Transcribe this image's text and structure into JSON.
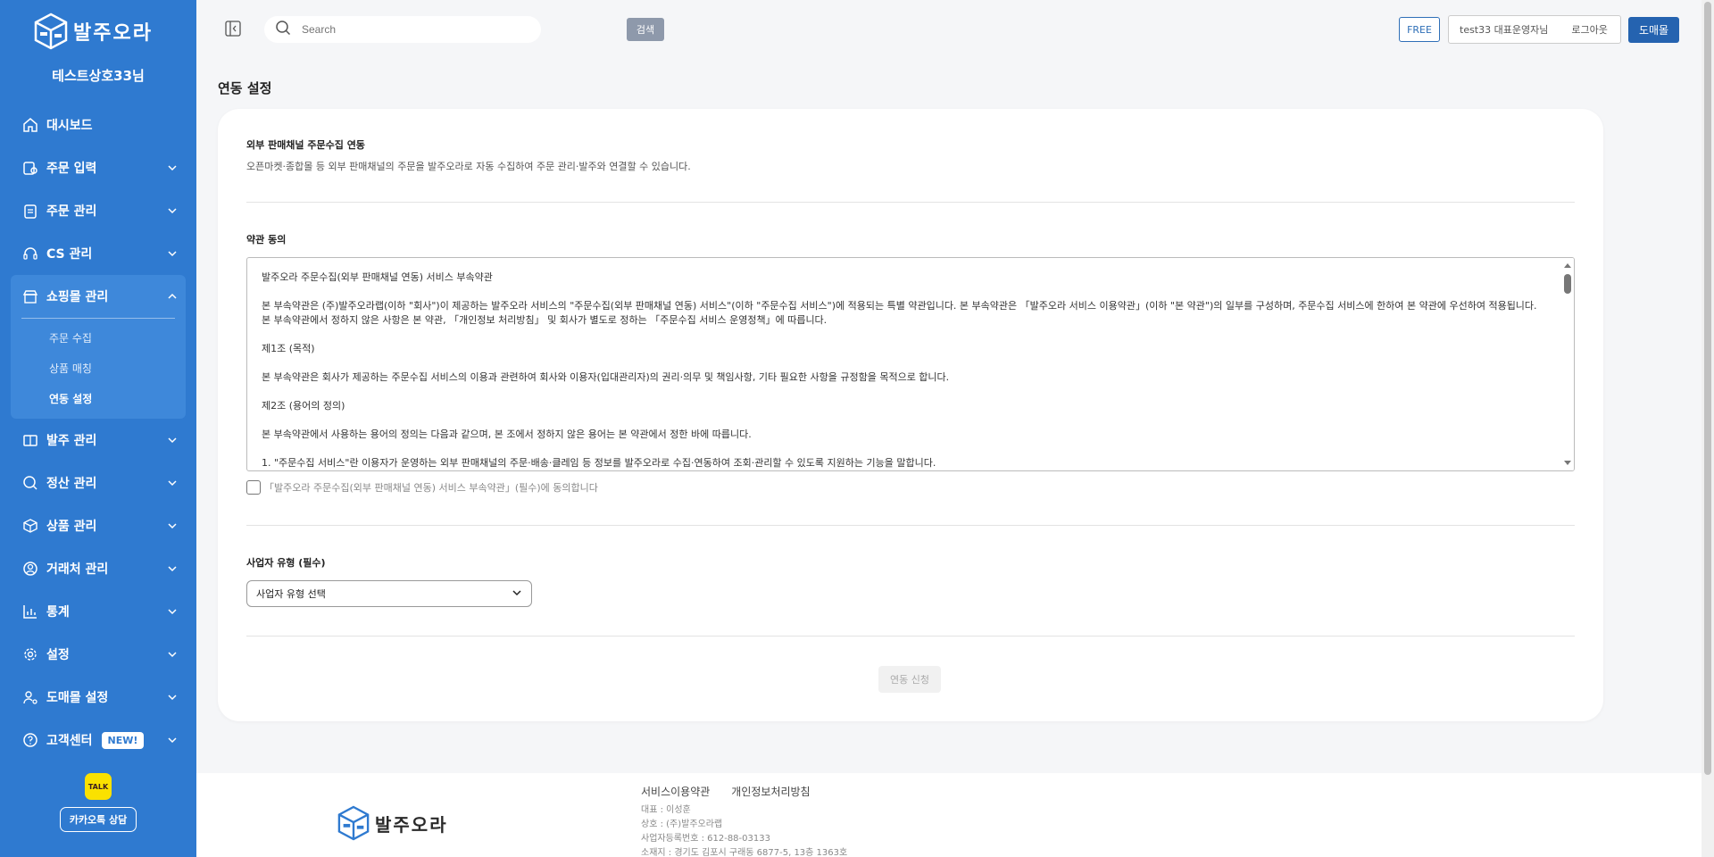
{
  "brand": {
    "name": "발주오라",
    "accent": "#2f7ad0"
  },
  "sidebar": {
    "company": "테스트상호33님",
    "items": [
      {
        "label": "대시보드",
        "icon": "home-icon"
      },
      {
        "label": "주문 입력",
        "icon": "order-input-icon"
      },
      {
        "label": "주문 관리",
        "icon": "clipboard-icon"
      },
      {
        "label": "CS 관리",
        "icon": "headset-icon"
      },
      {
        "label": "쇼핑몰 관리",
        "icon": "store-icon"
      },
      {
        "label": "발주 관리",
        "icon": "box-icon"
      },
      {
        "label": "정산 관리",
        "icon": "settlement-icon"
      },
      {
        "label": "상품 관리",
        "icon": "package-icon"
      },
      {
        "label": "거래처 관리",
        "icon": "user-circle-icon"
      },
      {
        "label": "통계",
        "icon": "chart-icon"
      },
      {
        "label": "설정",
        "icon": "gear-icon"
      },
      {
        "label": "도매몰 설정",
        "icon": "user-settings-icon"
      },
      {
        "label": "고객센터",
        "icon": "help-icon",
        "badge": "NEW!"
      }
    ],
    "shop_sub": [
      "주문 수집",
      "상품 매칭",
      "연동 설정"
    ],
    "kakao_icon": "TALK",
    "kakao_btn": "카카오톡 상담"
  },
  "topbar": {
    "search_placeholder": "Search",
    "search_btn": "검색",
    "plan": "FREE",
    "user": "test33 대표운영자님",
    "logout": "로그아웃",
    "mall_btn": "도매몰"
  },
  "main": {
    "title": "연동 설정",
    "section1_title": "외부 판매채널 주문수집 연동",
    "section1_desc": "오픈마켓·종합몰 등 외부 판매채널의 주문을 발주오라로 자동 수집하여 주문 관리·발주와 연결할 수 있습니다.",
    "terms_title": "약관 동의",
    "terms": [
      "발주오라 주문수집(외부 판매채널 연동) 서비스 부속약관",
      "본 부속약관은 (주)발주오라랩(이하 \"회사\")이 제공하는 발주오라 서비스의 \"주문수집(외부 판매채널 연동) 서비스\"(이하 \"주문수집 서비스\")에 적용되는 특별 약관입니다. 본 부속약관은 「발주오라 서비스 이용약관」(이하 \"본 약관\")의 일부를 구성하며, 주문수집 서비스에 한하여 본 약관에 우선하여 적용됩니다. 본 부속약관에서 정하지 않은 사항은 본 약관, 「개인정보 처리방침」 및 회사가 별도로 정하는 「주문수집 서비스 운영정책」에 따릅니다.",
      "제1조 (목적)",
      "본 부속약관은 회사가 제공하는 주문수집 서비스의 이용과 관련하여 회사와 이용자(입대관리자)의 권리·의무 및 책임사항, 기타 필요한 사항을 규정함을 목적으로 합니다.",
      "제2조 (용어의 정의)",
      "본 부속약관에서 사용하는 용어의 정의는 다음과 같으며, 본 조에서 정하지 않은 용어는 본 약관에서 정한 바에 따릅니다.",
      "1. \"주문수집 서비스\"란 이용자가 운영하는 외부 판매채널의 주문·배송·클레임 등 정보를 발주오라로 수집·연동하여 조회·관리할 수 있도록 지원하는 기능을 말합니다."
    ],
    "agree_label": "「발주오라 주문수집(외부 판매채널 연동) 서비스 부속약관」(필수)에 동의합니다",
    "biz_type_title": "사업자 유형 (필수)",
    "biz_type_value": "사업자 유형 선택",
    "apply_btn": "연동 신청"
  },
  "footer": {
    "links": [
      "서비스이용약관",
      "개인정보처리방침"
    ],
    "info": [
      "대표 : 이성훈",
      "상호 : (주)발주오라랩",
      "사업자등록번호 : 612-88-03133",
      "소재지 : 경기도 김포시 구래동 6877-5, 13층 1363호"
    ]
  }
}
